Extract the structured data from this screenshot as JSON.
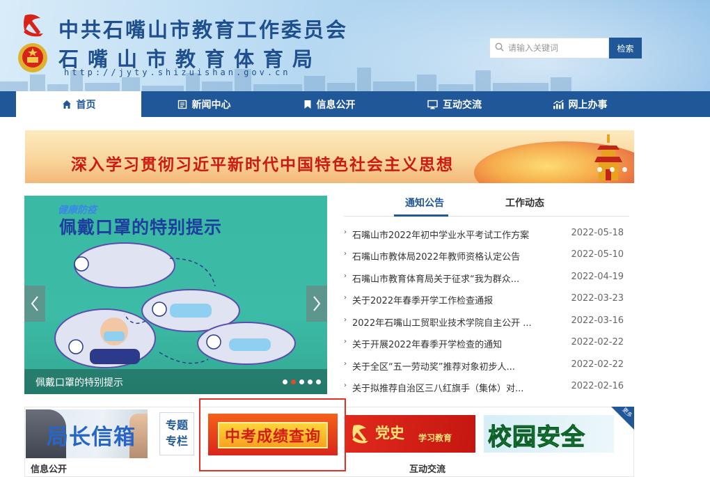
{
  "header": {
    "title_line1": "中共石嘴山市教育工作委员会",
    "title_line2": "石嘴山市教育体育局",
    "url": "http://jyty.shizuishan.gov.cn",
    "search": {
      "placeholder": "请输入关键词",
      "button_label": "检索"
    }
  },
  "nav": {
    "items": [
      {
        "label": "首页",
        "icon": "home-icon",
        "active": true
      },
      {
        "label": "新闻中心",
        "icon": "news-icon"
      },
      {
        "label": "信息公开",
        "icon": "bookmark-icon"
      },
      {
        "label": "互动交流",
        "icon": "monitor-icon"
      },
      {
        "label": "网上办事",
        "icon": "chart-icon"
      }
    ]
  },
  "banner": {
    "text": "深入学习贯彻习近平新时代中国特色社会主义思想"
  },
  "slider": {
    "poster_logo": "健康防疫",
    "poster_title": "佩戴口罩的特别提示",
    "caption": "佩戴口罩的特别提示",
    "slide_count": 5,
    "active_slide": 2
  },
  "news": {
    "tabs": [
      "通知公告",
      "工作动态"
    ],
    "active_tab": 0,
    "items": [
      {
        "title": "石嘴山市2022年初中学业水平考试工作方案",
        "date": "2022-05-18"
      },
      {
        "title": "石嘴山市教体局2022年教师资格认定公告",
        "date": "2022-05-10"
      },
      {
        "title": "石嘴山市教育体育局关于征求“我为群众...",
        "date": "2022-04-19"
      },
      {
        "title": "关于2022年春季开学工作检查通报",
        "date": "2022-03-23"
      },
      {
        "title": "2022年石嘴山工贸职业技术学院自主公开 ...",
        "date": "2022-03-16"
      },
      {
        "title": "关于开展2022年春季开学检查的通知",
        "date": "2022-02-22"
      },
      {
        "title": "关于全区“五一劳动奖”推荐对象初步人...",
        "date": "2022-02-22"
      },
      {
        "title": "关于拟推荐自治区三八红旗手（集体）对...",
        "date": "2022-02-16"
      }
    ]
  },
  "bottom": {
    "mailbox_text": "局长信箱",
    "zhuanti_line1": "专题",
    "zhuanti_line2": "专栏",
    "exam_text": "中考成绩查询",
    "party_text": "党史",
    "party_sub": "学习教育",
    "safety_text": "校园安全",
    "more_label": "更多",
    "label_info": "信息公开",
    "label_interact": "互动交流"
  },
  "colors": {
    "brand_blue": "#1f5799",
    "highlight_red": "#e3312a",
    "party_red": "#d41d12"
  }
}
